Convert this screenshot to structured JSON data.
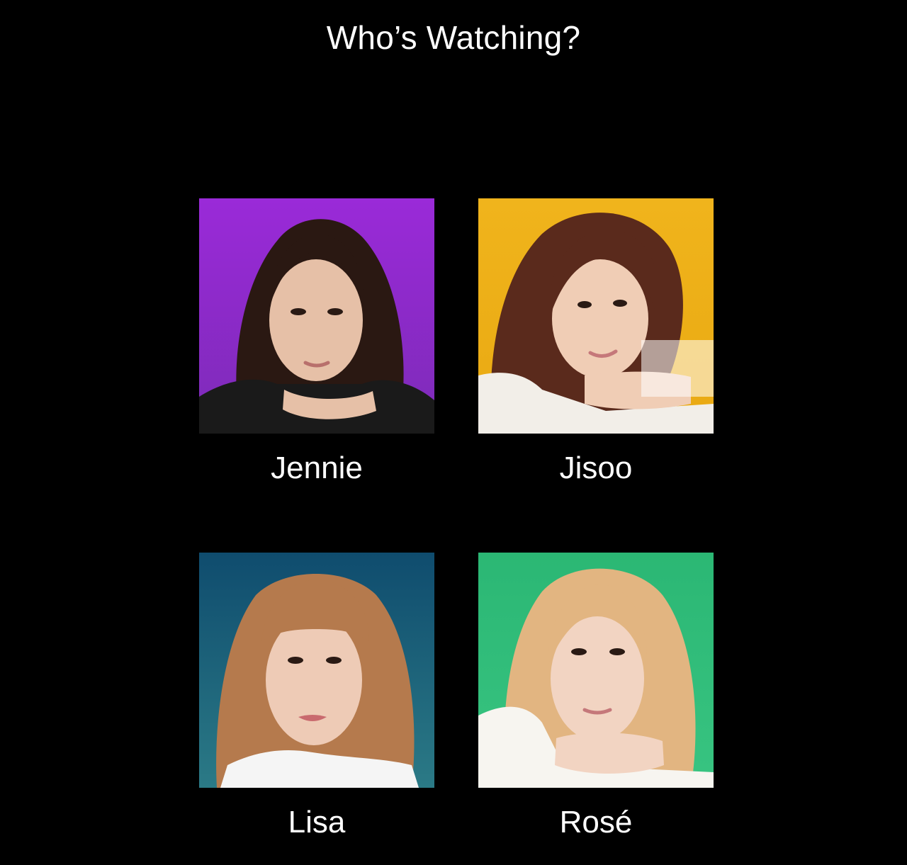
{
  "header": {
    "title": "Who’s Watching?"
  },
  "profiles": [
    {
      "name": "Jennie",
      "bg_top": "#9a2ad8",
      "bg_bottom": "#7d2bb8",
      "hair": "#2a1812",
      "skin": "#e6c0a7",
      "top": "#1a1a1a"
    },
    {
      "name": "Jisoo",
      "bg_top": "#f0b41c",
      "bg_bottom": "#e9a912",
      "hair": "#5a2a1c",
      "skin": "#f0cdb5",
      "top": "#f2eee8"
    },
    {
      "name": "Lisa",
      "bg_top": "#0f4c6e",
      "bg_bottom": "#2b7a86",
      "hair": "#b57a4d",
      "skin": "#eecbb6",
      "top": "#f5f5f5"
    },
    {
      "name": "Rosé",
      "bg_top": "#2bb774",
      "bg_bottom": "#38c481",
      "hair": "#e2b581",
      "skin": "#f2d4c2",
      "top": "#f7f5f0"
    }
  ]
}
